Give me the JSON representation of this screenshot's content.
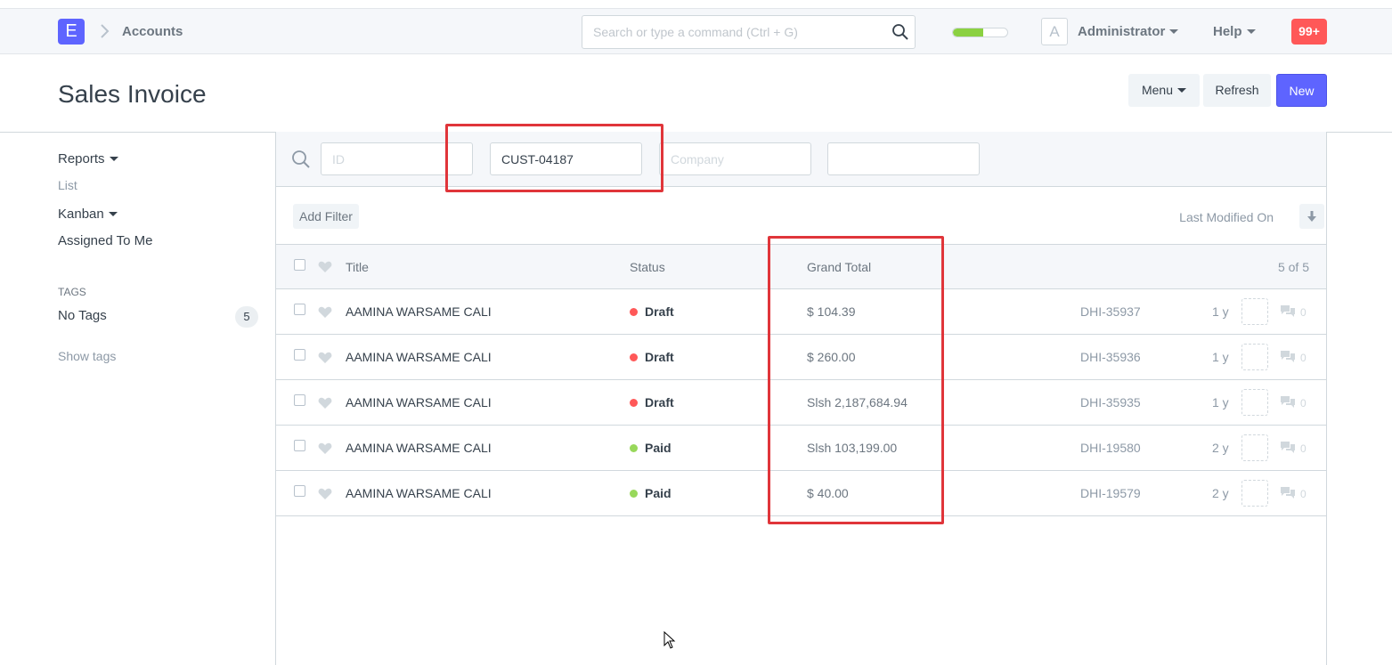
{
  "navbar": {
    "logo_letter": "E",
    "breadcrumb": "Accounts",
    "search_placeholder": "Search or type a command (Ctrl + G)",
    "progress": 0.55,
    "avatar_letter": "A",
    "user": "Administrator",
    "help": "Help",
    "notifications": "99+"
  },
  "page": {
    "title": "Sales Invoice",
    "menu_label": "Menu",
    "refresh_label": "Refresh",
    "new_label": "New"
  },
  "sidebar": {
    "reports": "Reports",
    "list": "List",
    "kanban": "Kanban",
    "assigned": "Assigned To Me",
    "tags_heading": "TAGS",
    "no_tags": "No Tags",
    "no_tags_count": "5",
    "show_tags": "Show tags"
  },
  "filters": {
    "id_placeholder": "ID",
    "customer_value": "CUST-04187",
    "company_placeholder": "Company",
    "fourth_value": ""
  },
  "toolbar": {
    "add_filter": "Add Filter",
    "sort_label": "Last Modified On"
  },
  "list": {
    "headers": {
      "title": "Title",
      "status": "Status",
      "grand_total": "Grand Total",
      "count": "5 of 5"
    },
    "rows": [
      {
        "title": "AAMINA WARSAME CALI",
        "status": "Draft",
        "status_color": "#ff5858",
        "grand_total": "$ 104.39",
        "id": "DHI-35937",
        "age": "1 y",
        "comments": "0"
      },
      {
        "title": "AAMINA WARSAME CALI",
        "status": "Draft",
        "status_color": "#ff5858",
        "grand_total": "$ 260.00",
        "id": "DHI-35936",
        "age": "1 y",
        "comments": "0"
      },
      {
        "title": "AAMINA WARSAME CALI",
        "status": "Draft",
        "status_color": "#ff5858",
        "grand_total": "Slsh 2,187,684.94",
        "id": "DHI-35935",
        "age": "1 y",
        "comments": "0"
      },
      {
        "title": "AAMINA WARSAME CALI",
        "status": "Paid",
        "status_color": "#98d85b",
        "grand_total": "Slsh 103,199.00",
        "id": "DHI-19580",
        "age": "2 y",
        "comments": "0"
      },
      {
        "title": "AAMINA WARSAME CALI",
        "status": "Paid",
        "status_color": "#98d85b",
        "grand_total": "$ 40.00",
        "id": "DHI-19579",
        "age": "2 y",
        "comments": "0"
      }
    ]
  },
  "colors": {
    "accent": "#5e64ff",
    "highlight": "#e0353a",
    "draft": "#ff5858",
    "paid": "#98d85b"
  }
}
